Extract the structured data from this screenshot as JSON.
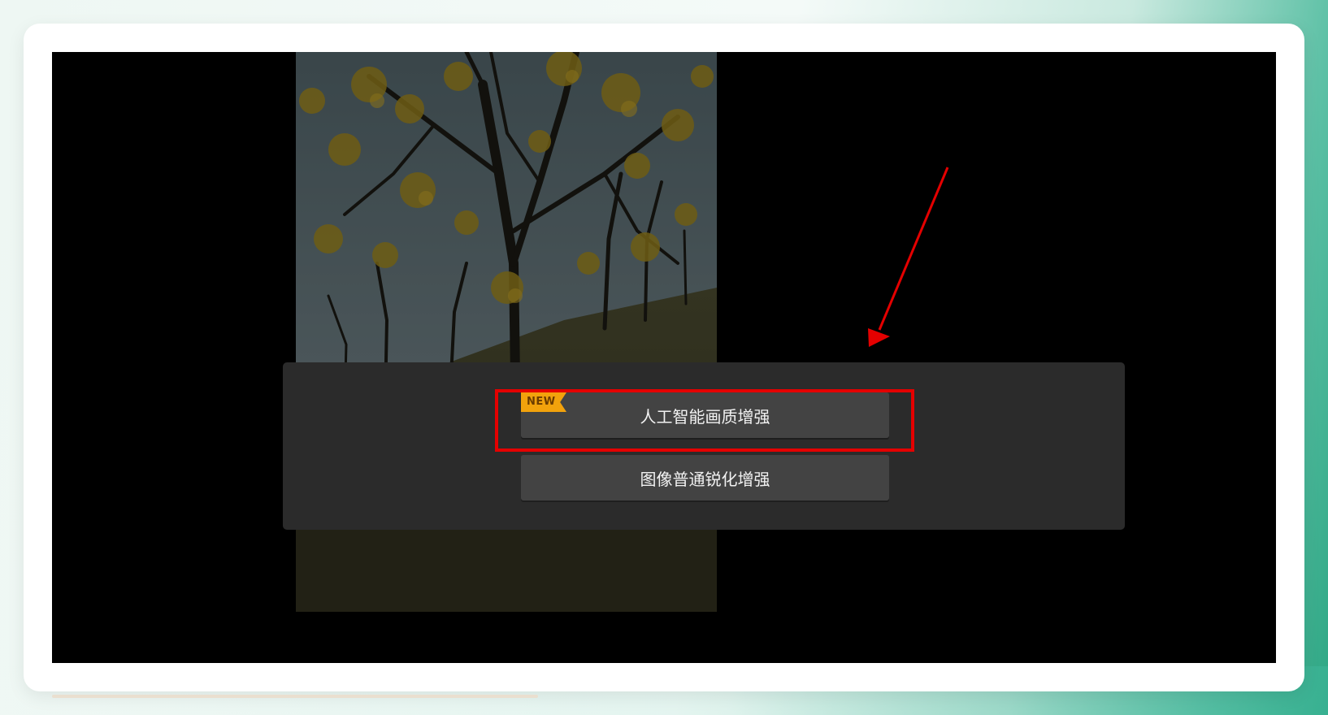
{
  "dialog": {
    "options": [
      {
        "label": "人工智能画质增强",
        "badge": "NEW"
      },
      {
        "label": "图像普通锐化增强"
      }
    ]
  },
  "colors": {
    "panel": "#2b2b2b",
    "button": "#434343",
    "badge": "#f2a20c",
    "annotation": "#e40000"
  },
  "icons": {
    "annotation_arrow": "arrow-icon"
  }
}
